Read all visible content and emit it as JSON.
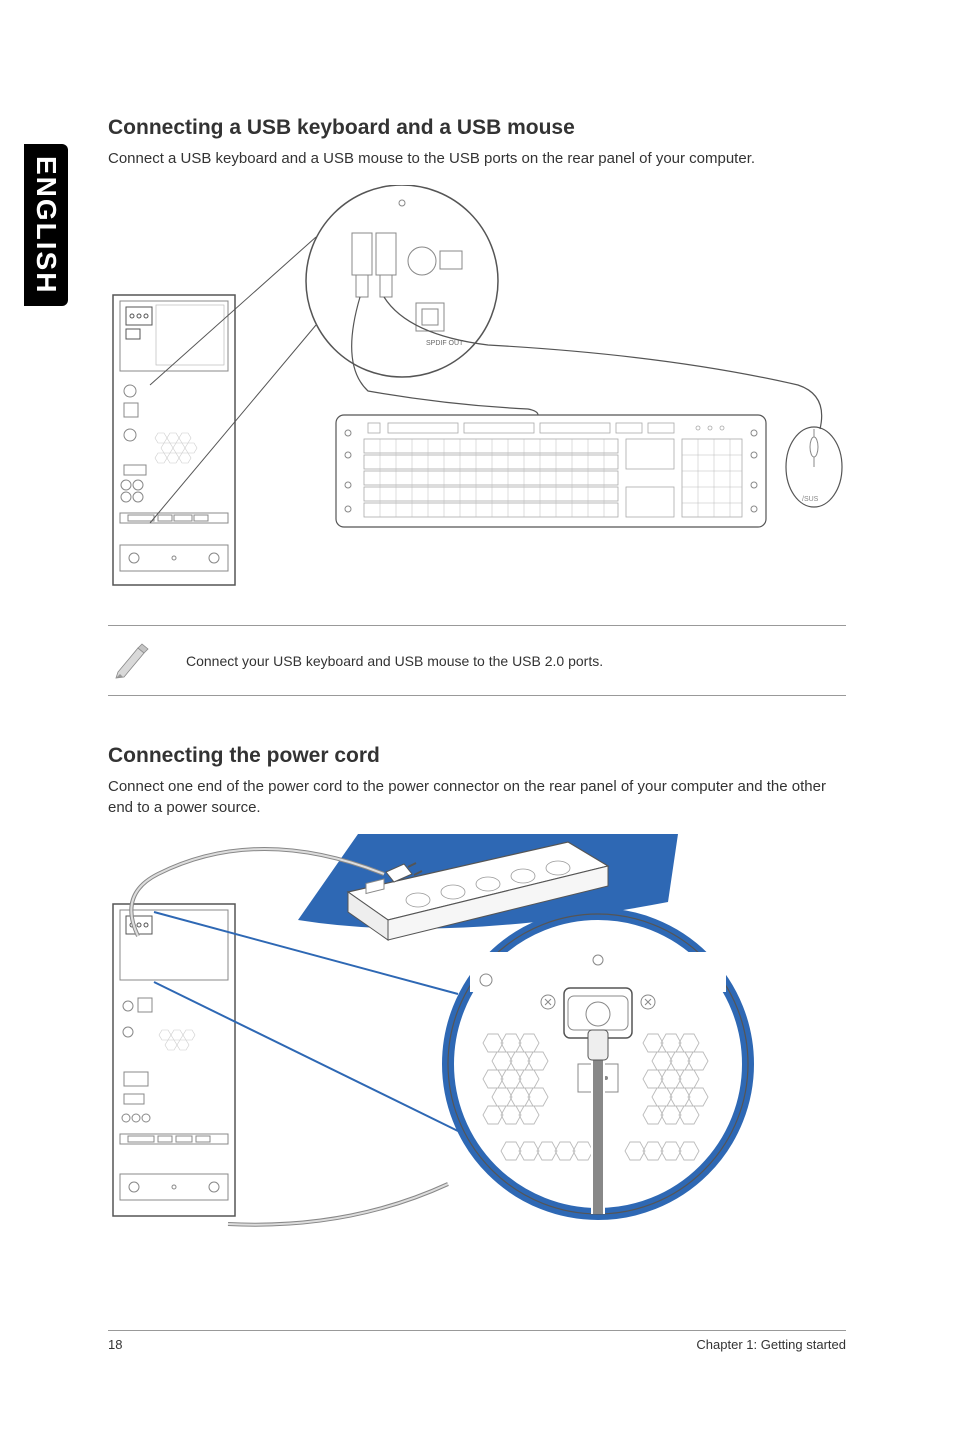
{
  "sidebar": {
    "language": "ENGLISH"
  },
  "sections": [
    {
      "heading": "Connecting a USB keyboard and a USB mouse",
      "body": "Connect a USB keyboard and a USB mouse to the USB ports on the rear panel of your computer.",
      "note": "Connect your USB keyboard and USB mouse to the USB 2.0 ports.",
      "diagram_labels": {
        "port_label": "SPDIF OUT",
        "brand": "/SUS"
      }
    },
    {
      "heading": "Connecting the power cord",
      "body": "Connect one end of the power cord to the power connector on the rear panel of your computer and the other end to a power source."
    }
  ],
  "footer": {
    "page_number": "18",
    "chapter": "Chapter 1: Getting started"
  }
}
